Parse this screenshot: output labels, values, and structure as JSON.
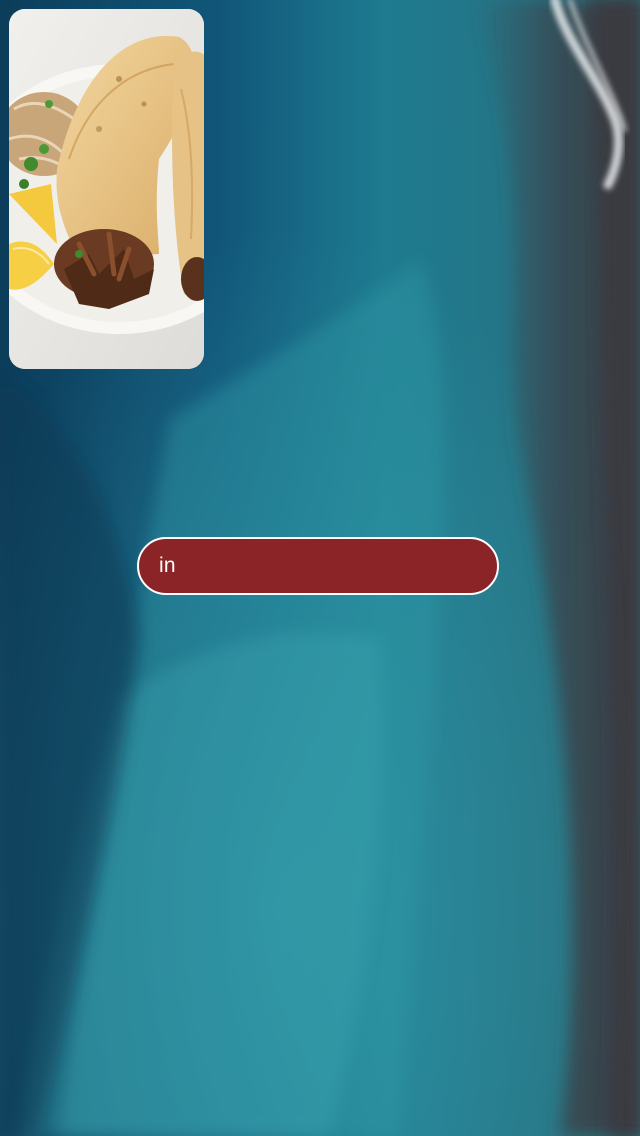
{
  "background": {
    "scene": "aerial-ocean-shoreline",
    "deep_water_color": "#0e4d6d",
    "shallow_water_color": "#2b8ea0",
    "sand_color": "#3b3a3f"
  },
  "media_preview": {
    "subject": "wrapped-flatbread-with-meat",
    "plate_color": "#f7f6f3"
  },
  "input": {
    "value": "in",
    "fill_color": "#8b2427",
    "border_color": "#ffffff"
  }
}
